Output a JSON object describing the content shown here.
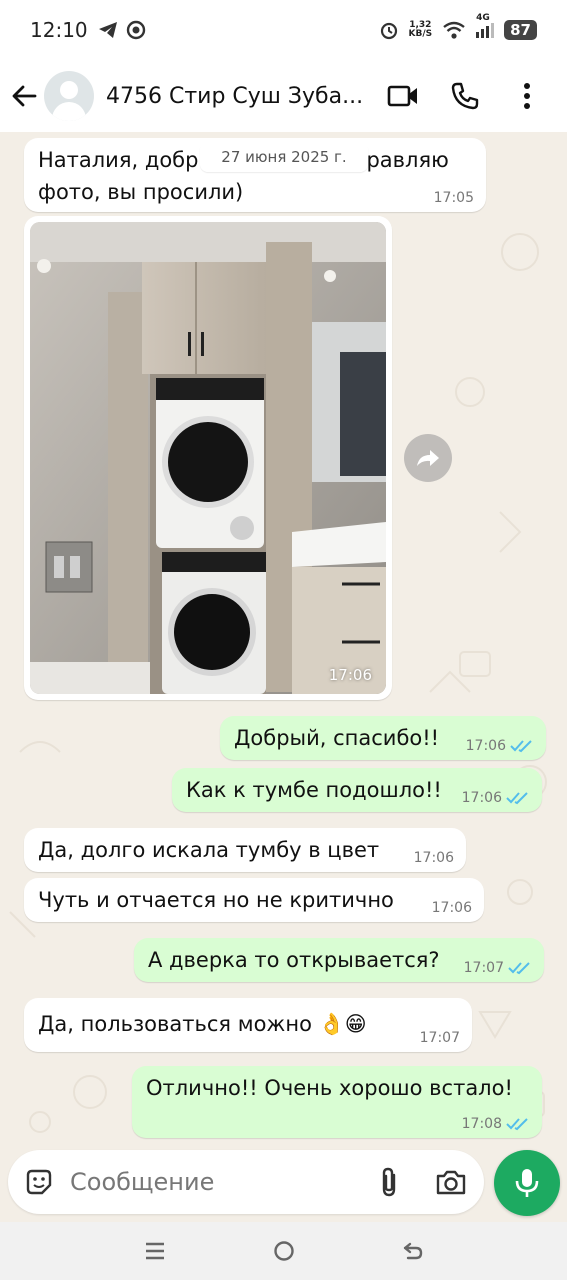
{
  "status_bar": {
    "time": "12:10",
    "net_speed_value": "1,32",
    "net_speed_unit": "KB/S",
    "network_type": "4G",
    "battery": "87"
  },
  "header": {
    "chat_title": "4756 Стир Суш Зуба..."
  },
  "chat": {
    "date_chip": "27 июня 2025 г.",
    "messages": [
      {
        "dir": "in",
        "text_line1": "Наталия, добр",
        "text_line1_end": "равляю",
        "text_line2": "фото, вы просили)",
        "time": "17:05"
      },
      {
        "dir": "in",
        "type": "photo",
        "time": "17:06"
      },
      {
        "dir": "out",
        "text": "Добрый, спасибо!!",
        "time": "17:06"
      },
      {
        "dir": "out",
        "text": "Как к тумбе подошло!!",
        "time": "17:06"
      },
      {
        "dir": "in",
        "text": "Да, долго искала тумбу в цвет",
        "time": "17:06"
      },
      {
        "dir": "in",
        "text": "Чуть и отчается но не критично",
        "time": "17:06"
      },
      {
        "dir": "out",
        "text": "А дверка то открывается?",
        "time": "17:07"
      },
      {
        "dir": "in",
        "text": "Да, пользоваться можно 👌😁",
        "time": "17:07"
      },
      {
        "dir": "out",
        "text": "Отлично!! Очень хорошо встало!",
        "time": "17:08"
      }
    ]
  },
  "composer": {
    "placeholder": "Сообщение"
  },
  "colors": {
    "incoming_bubble": "#ffffff",
    "outgoing_bubble": "#d9fdd3",
    "read_ticks": "#53bdeb",
    "mic_button": "#1daa61",
    "chat_background": "#f3eee6"
  },
  "icons": {
    "back": "arrow-left-icon",
    "video": "video-camera-icon",
    "call": "phone-icon",
    "menu": "more-vertical-icon",
    "forward": "forward-icon",
    "sticker": "sticker-icon",
    "attach": "paperclip-icon",
    "camera": "camera-icon",
    "mic": "microphone-icon"
  }
}
